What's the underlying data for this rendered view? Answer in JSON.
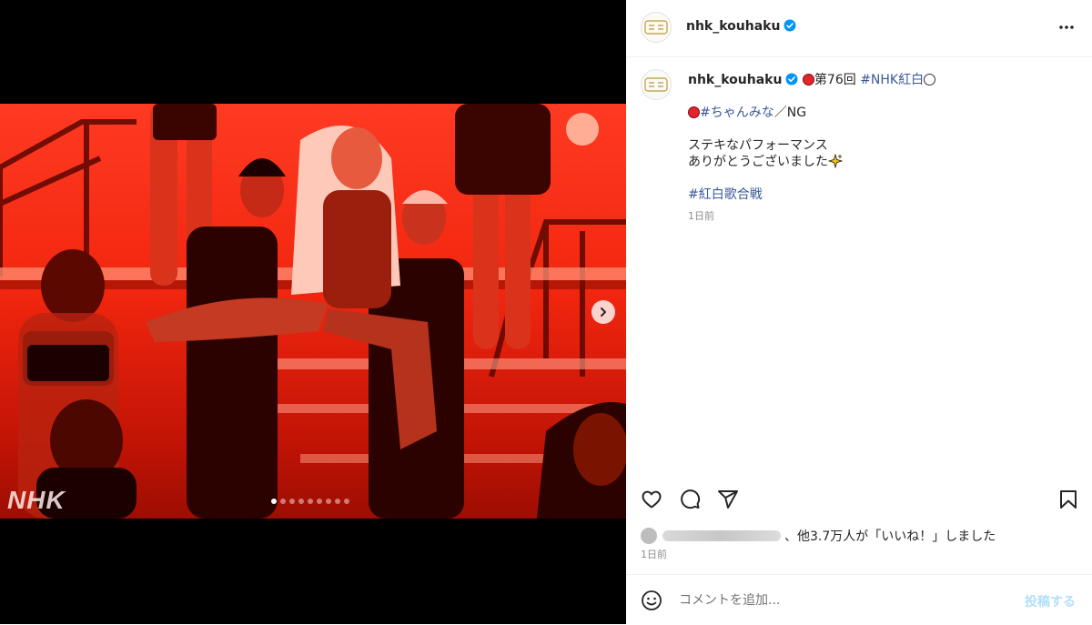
{
  "media": {
    "watermark": "NHK",
    "carousel_total": 9,
    "carousel_active": 1,
    "next_icon": "chevron-right-icon"
  },
  "post": {
    "account": "nhk_kouhaku",
    "verified": true,
    "avatar_text": "紅白",
    "caption": {
      "line1_text": "第76回",
      "line1_tag": "#NHK紅白",
      "line2_tag": "#ちゃんみな",
      "line2_text": "／NG",
      "line3": "ステキなパフォーマンス",
      "line4": "ありがとうございました",
      "line4_emoji": "sparkle-icon",
      "line5_tag": "#紅白歌合戦"
    },
    "caption_time": "1日前",
    "likes_text": "、他3.7万人が「いいね！」しました",
    "post_time": "1日前"
  },
  "actions": [
    "heart-icon",
    "comment-icon",
    "share-icon",
    "bookmark-icon"
  ],
  "comment": {
    "placeholder": "コメントを追加...",
    "submit_label": "投稿する"
  },
  "colors": {
    "link": "#385898",
    "verified": "#0095f6",
    "post_button_disabled": "#b2dffc"
  }
}
